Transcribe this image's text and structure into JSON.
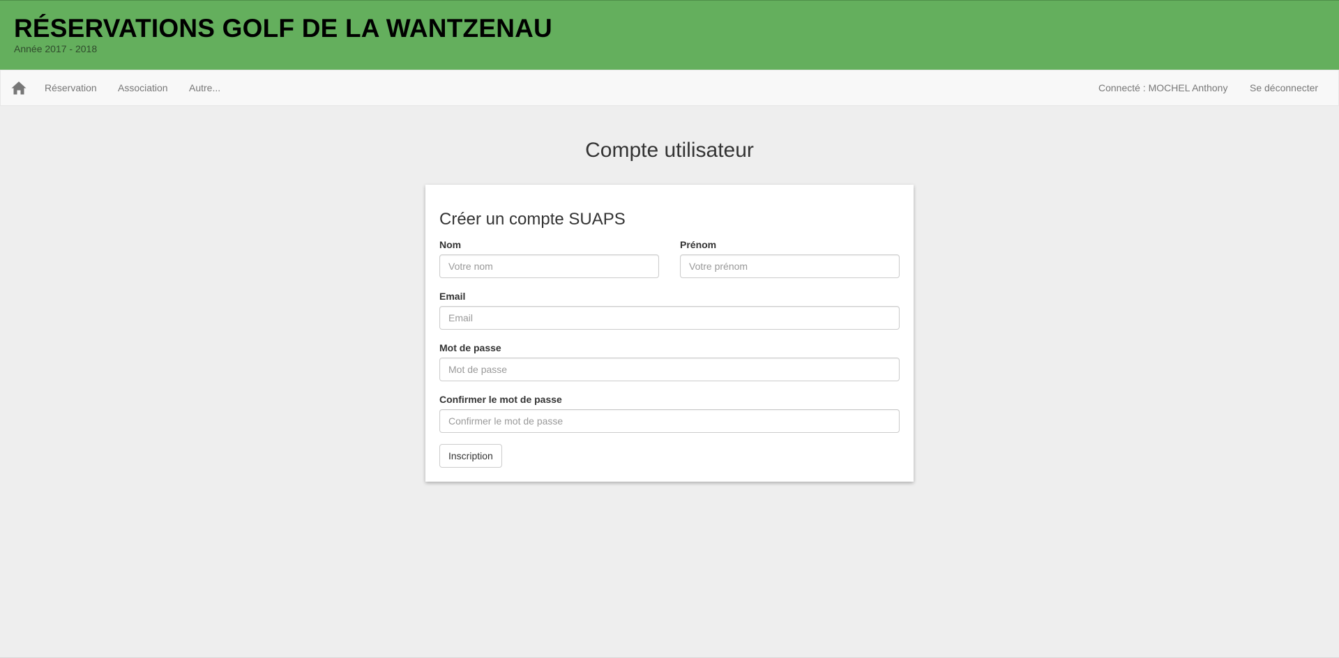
{
  "header": {
    "title": "RÉSERVATIONS GOLF DE LA WANTZENAU",
    "subtitle": "Année 2017 - 2018",
    "background_color": "#64af5d"
  },
  "navbar": {
    "home_icon": "home-icon",
    "links": [
      {
        "label": "Réservation"
      },
      {
        "label": "Association"
      },
      {
        "label": "Autre..."
      }
    ],
    "user_status": "Connecté : MOCHEL Anthony",
    "logout_label": "Se déconnecter"
  },
  "page": {
    "title": "Compte utilisateur"
  },
  "form": {
    "heading": "Créer un compte SUAPS",
    "last_name": {
      "label": "Nom",
      "placeholder": "Votre nom",
      "value": ""
    },
    "first_name": {
      "label": "Prénom",
      "placeholder": "Votre prénom",
      "value": ""
    },
    "email": {
      "label": "Email",
      "placeholder": "Email",
      "value": ""
    },
    "password": {
      "label": "Mot de passe",
      "placeholder": "Mot de passe",
      "value": ""
    },
    "password_confirm": {
      "label": "Confirmer le mot de passe",
      "placeholder": "Confirmer le mot de passe",
      "value": ""
    },
    "submit_label": "Inscription"
  }
}
